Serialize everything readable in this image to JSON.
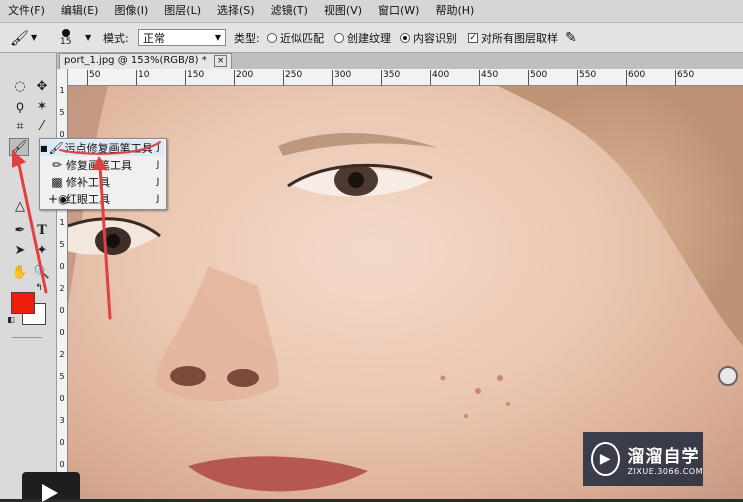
{
  "menu": [
    "文件(F)",
    "编辑(E)",
    "图像(I)",
    "图层(L)",
    "选择(S)",
    "滤镜(T)",
    "视图(V)",
    "窗口(W)",
    "帮助(H)"
  ],
  "options": {
    "brush_size": "15",
    "mode_label": "模式:",
    "mode_value": "正常",
    "type_label": "类型:",
    "type_options": [
      "近似匹配",
      "创建纹理",
      "内容识别"
    ],
    "type_selected": "内容识别",
    "sample_all_layers": "对所有图层取样"
  },
  "document": {
    "tab_title": "port_1.jpg @ 153%(RGB/8) *",
    "close_glyph": "×"
  },
  "ruler": {
    "top": [
      "50",
      "10",
      "150",
      "200",
      "250",
      "300",
      "350",
      "400",
      "450",
      "500",
      "550",
      "600",
      "650"
    ],
    "left": [
      "1",
      "5",
      "0",
      "1",
      "0",
      "0",
      "1",
      "5",
      "0",
      "2",
      "0",
      "0",
      "2",
      "5",
      "0",
      "3",
      "0",
      "0"
    ]
  },
  "flyout": {
    "items": [
      {
        "label": "污点修复画笔工具",
        "key": "J",
        "icon": "spot-healing-brush-icon"
      },
      {
        "label": "修复画笔工具",
        "key": "J",
        "icon": "healing-brush-icon"
      },
      {
        "label": "修补工具",
        "key": "J",
        "icon": "patch-icon"
      },
      {
        "label": "红眼工具",
        "key": "J",
        "icon": "red-eye-icon"
      }
    ]
  },
  "colors": {
    "foreground": "#ee1c0a",
    "background": "#ffffff",
    "annotation_arrow": "#e04040"
  },
  "watermark": {
    "title": "溜溜自学",
    "url": "ZIXUE.3066.COM"
  }
}
